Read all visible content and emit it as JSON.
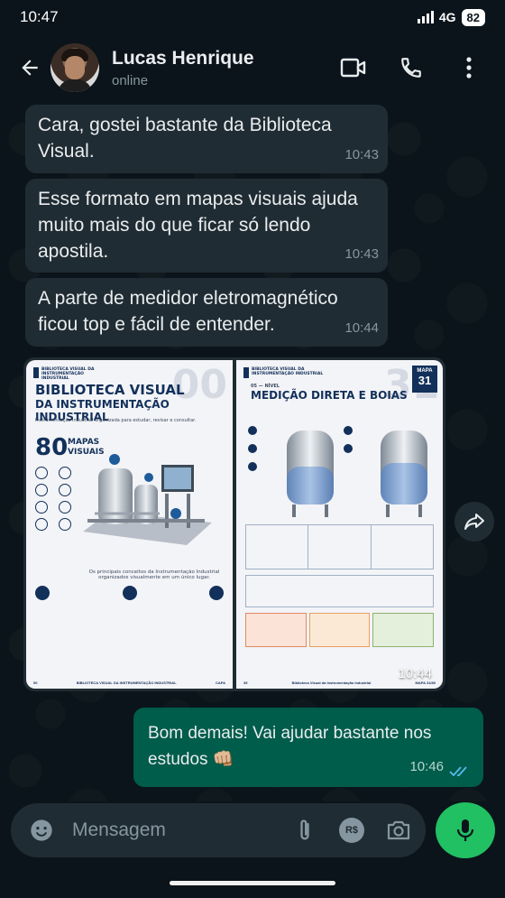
{
  "status": {
    "time": "10:47",
    "network": "4G",
    "battery": "82"
  },
  "header": {
    "name": "Lucas Henrique",
    "status": "online"
  },
  "messages": {
    "m1": {
      "text": "Cara, gostei bastante da Biblioteca Visual.",
      "time": "10:43"
    },
    "m2": {
      "text": "Esse formato em mapas visuais ajuda muito mais do que ficar só lendo apostila.",
      "time": "10:43"
    },
    "m3": {
      "text": "A parte de medidor eletromagnético ficou top e fácil de entender.",
      "time": "10:44"
    },
    "image": {
      "time": "10:44",
      "left_page": {
        "brand": "BIBLIOTECA VISUAL DA INSTRUMENTAÇÃO INDUSTRIAL",
        "number": "00",
        "title_line1": "BIBLIOTECA VISUAL",
        "title_line2": "DA INSTRUMENTAÇÃO INDUSTRIAL",
        "subtitle": "Instrumentação Industrial organizada para estudar, revisar e consultar.",
        "count": "80",
        "count_label_1": "MAPAS",
        "count_label_2": "VISUAIS",
        "bottom_text": "Os principais conceitos da Instrumentação Industrial organizados visualmente em um único lugar.",
        "footer_left": "00",
        "footer_center": "BIBLIOTECA VISUAL DA INSTRUMENTAÇÃO INDUSTRIAL",
        "footer_right": "CAPA"
      },
      "right_page": {
        "brand": "BIBLIOTECA VISUAL DA INSTRUMENTAÇÃO INDUSTRIAL",
        "section": "05 — NÍVEL",
        "title": "MEDIÇÃO DIRETA E BOIAS",
        "number": "31",
        "map_label": "MAPA",
        "map_number": "31",
        "footer_left": "39",
        "footer_center": "Biblioteca Visual da Instrumentação Industrial",
        "footer_right": "MAPA 31/80"
      }
    },
    "m4": {
      "text": "Bom demais! Vai ajudar bastante nos estudos 👊🏼",
      "time": "10:46"
    }
  },
  "composer": {
    "placeholder": "Mensagem"
  },
  "icons": {
    "back": "arrow-left-icon",
    "video": "video-camera-icon",
    "call": "phone-icon",
    "menu": "more-vertical-icon",
    "emoji": "emoji-icon",
    "attach": "paperclip-icon",
    "payment": "currency-icon",
    "camera": "camera-icon",
    "mic": "microphone-icon",
    "forward": "forward-icon",
    "read": "double-check-icon"
  },
  "colors": {
    "background": "#0b141a",
    "incoming": "#202c33",
    "outgoing": "#005c4b",
    "accent": "#21c063",
    "read_ticks": "#53bdeb"
  }
}
